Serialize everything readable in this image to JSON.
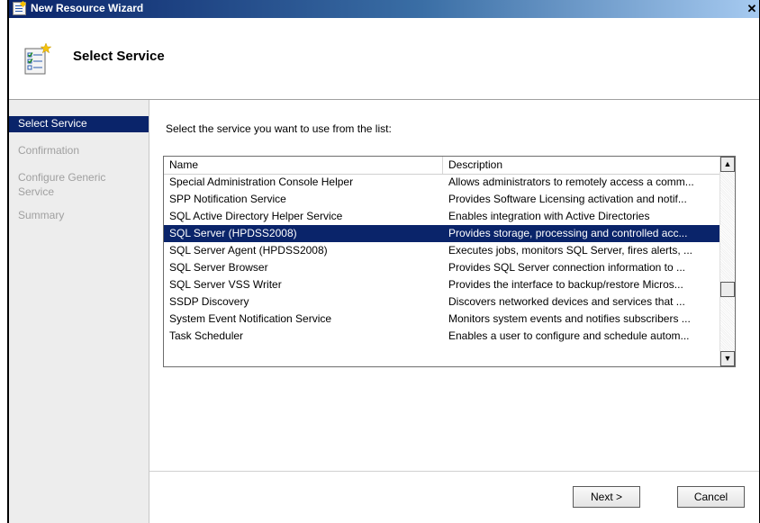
{
  "window": {
    "title": "New Resource Wizard",
    "close_label": "✕"
  },
  "header": {
    "title": "Select Service",
    "icon": "wizard-checklist-icon"
  },
  "nav": {
    "items": [
      {
        "label": "Select Service",
        "selected": true
      },
      {
        "label": "Confirmation",
        "selected": false
      },
      {
        "label": "Configure Generic Service",
        "selected": false
      },
      {
        "label": "Summary",
        "selected": false
      }
    ]
  },
  "main": {
    "instruction": "Select the service you want to use from the list:",
    "list": {
      "columns": [
        "Name",
        "Description"
      ],
      "rows": [
        {
          "name": "Special Administration Console Helper",
          "description": "Allows administrators to remotely access a comm..."
        },
        {
          "name": "SPP Notification Service",
          "description": "Provides Software Licensing activation and notif..."
        },
        {
          "name": "SQL Active Directory Helper Service",
          "description": "Enables integration with Active Directories"
        },
        {
          "name": "SQL Server (HPDSS2008)",
          "description": "Provides storage, processing and controlled acc...",
          "selected": true
        },
        {
          "name": "SQL Server Agent (HPDSS2008)",
          "description": "Executes jobs, monitors SQL Server, fires alerts, ..."
        },
        {
          "name": "SQL Server Browser",
          "description": "Provides SQL Server connection information to ..."
        },
        {
          "name": "SQL Server VSS Writer",
          "description": "Provides the interface to backup/restore Micros..."
        },
        {
          "name": "SSDP Discovery",
          "description": "Discovers networked devices and services that ..."
        },
        {
          "name": "System Event Notification Service",
          "description": "Monitors system events and notifies subscribers ..."
        },
        {
          "name": "Task Scheduler",
          "description": "Enables a user to configure and schedule autom..."
        }
      ]
    }
  },
  "footer": {
    "next_label": "Next >",
    "cancel_label": "Cancel"
  },
  "colors": {
    "selection": "#0a246a",
    "title_gradient_start": "#0a246a",
    "title_gradient_end": "#a6caf0"
  }
}
